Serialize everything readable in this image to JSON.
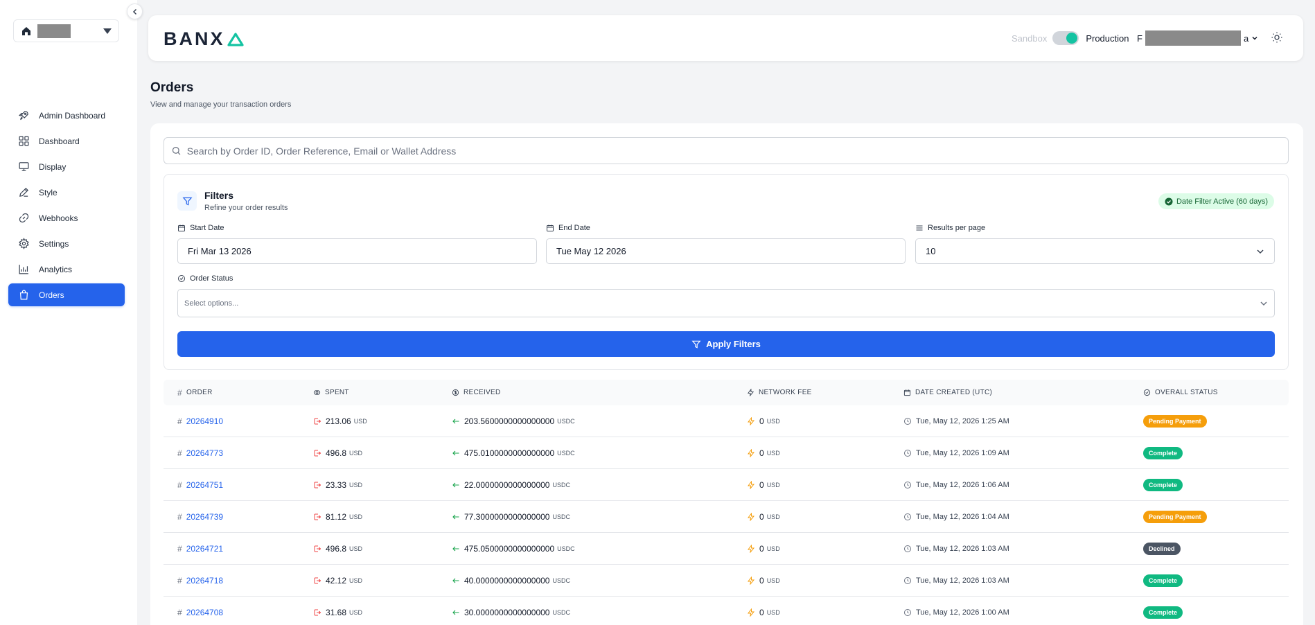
{
  "brand": {
    "logo_text": "BANX"
  },
  "colors": {
    "accent": "#2563eb",
    "toggle": "#14c3a2",
    "pending": "#f59e0b",
    "complete": "#10b981",
    "declined": "#4b5563"
  },
  "sidebar": {
    "workspace_icon": "home-icon",
    "items": [
      {
        "label": "Admin Dashboard",
        "icon": "rocket-icon"
      },
      {
        "label": "Dashboard",
        "icon": "grid-icon"
      },
      {
        "label": "Display",
        "icon": "monitor-icon"
      },
      {
        "label": "Style",
        "icon": "pencil-icon"
      },
      {
        "label": "Webhooks",
        "icon": "link-icon"
      },
      {
        "label": "Settings",
        "icon": "gear-icon"
      },
      {
        "label": "Analytics",
        "icon": "bar-chart-icon"
      },
      {
        "label": "Orders",
        "icon": "shopping-bag-icon",
        "active": true
      }
    ]
  },
  "header": {
    "sandbox_label": "Sandbox",
    "production_label": "Production",
    "user_prefix": "F",
    "user_suffix": "a"
  },
  "page": {
    "title": "Orders",
    "subtitle": "View and manage your transaction orders"
  },
  "search": {
    "placeholder": "Search by Order ID, Order Reference, Email or Wallet Address"
  },
  "filters": {
    "title": "Filters",
    "subtitle": "Refine your order results",
    "badge": "Date Filter Active (60 days)",
    "start_date_label": "Start Date",
    "start_date_value": "Fri Mar 13 2026",
    "end_date_label": "End Date",
    "end_date_value": "Tue May 12 2026",
    "results_label": "Results per page",
    "results_value": "10",
    "status_label": "Order Status",
    "status_placeholder": "Select options...",
    "apply_label": "Apply Filters"
  },
  "table": {
    "headers": {
      "order": "ORDER",
      "spent": "SPENT",
      "received": "RECEIVED",
      "fee": "NETWORK FEE",
      "date": "DATE CREATED (UTC)",
      "status": "OVERALL STATUS"
    },
    "rows": [
      {
        "order": "20264910",
        "spent": "213.06",
        "spent_unit": "USD",
        "received": "203.5600000000000000",
        "received_unit": "USDC",
        "fee": "0",
        "fee_unit": "USD",
        "date": "Tue, May 12, 2026 1:25 AM",
        "status": "Pending Payment",
        "status_kind": "pending"
      },
      {
        "order": "20264773",
        "spent": "496.8",
        "spent_unit": "USD",
        "received": "475.0100000000000000",
        "received_unit": "USDC",
        "fee": "0",
        "fee_unit": "USD",
        "date": "Tue, May 12, 2026 1:09 AM",
        "status": "Complete",
        "status_kind": "complete"
      },
      {
        "order": "20264751",
        "spent": "23.33",
        "spent_unit": "USD",
        "received": "22.0000000000000000",
        "received_unit": "USDC",
        "fee": "0",
        "fee_unit": "USD",
        "date": "Tue, May 12, 2026 1:06 AM",
        "status": "Complete",
        "status_kind": "complete"
      },
      {
        "order": "20264739",
        "spent": "81.12",
        "spent_unit": "USD",
        "received": "77.3000000000000000",
        "received_unit": "USDC",
        "fee": "0",
        "fee_unit": "USD",
        "date": "Tue, May 12, 2026 1:04 AM",
        "status": "Pending Payment",
        "status_kind": "pending"
      },
      {
        "order": "20264721",
        "spent": "496.8",
        "spent_unit": "USD",
        "received": "475.0500000000000000",
        "received_unit": "USDC",
        "fee": "0",
        "fee_unit": "USD",
        "date": "Tue, May 12, 2026 1:03 AM",
        "status": "Declined",
        "status_kind": "declined"
      },
      {
        "order": "20264718",
        "spent": "42.12",
        "spent_unit": "USD",
        "received": "40.0000000000000000",
        "received_unit": "USDC",
        "fee": "0",
        "fee_unit": "USD",
        "date": "Tue, May 12, 2026 1:03 AM",
        "status": "Complete",
        "status_kind": "complete"
      },
      {
        "order": "20264708",
        "spent": "31.68",
        "spent_unit": "USD",
        "received": "30.0000000000000000",
        "received_unit": "USDC",
        "fee": "0",
        "fee_unit": "USD",
        "date": "Tue, May 12, 2026 1:00 AM",
        "status": "Complete",
        "status_kind": "complete"
      }
    ]
  }
}
